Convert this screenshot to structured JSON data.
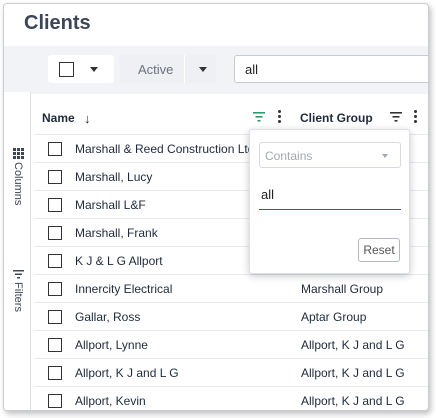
{
  "page": {
    "title": "Clients"
  },
  "toolbar": {
    "status_value": "Active",
    "search_value": "all"
  },
  "side_tabs": {
    "columns": "Columns",
    "filters": "Filters"
  },
  "grid": {
    "columns": [
      {
        "label": "Name",
        "sort": "↓"
      },
      {
        "label": "Client Group"
      }
    ],
    "rows": [
      {
        "name": "Marshall & Reed Construction Ltd",
        "group": ""
      },
      {
        "name": "Marshall, Lucy",
        "group": ""
      },
      {
        "name": "Marshall L&F",
        "group": ""
      },
      {
        "name": "Marshall, Frank",
        "group": ""
      },
      {
        "name": "K J & L G Allport",
        "group": ""
      },
      {
        "name": "Innercity Electrical",
        "group": "Marshall Group"
      },
      {
        "name": "Gallar, Ross",
        "group": "Aptar Group"
      },
      {
        "name": "Allport, Lynne",
        "group": "Allport, K J and L G"
      },
      {
        "name": "Allport, K J and L G",
        "group": "Allport, K J and L G"
      },
      {
        "name": "Allport, Kevin",
        "group": "Allport, K J and L G"
      }
    ]
  },
  "filter_popup": {
    "condition": "Contains",
    "value": "all",
    "reset_label": "Reset"
  },
  "colors": {
    "accent": "#3b5b85",
    "filter_active": "#2a9d6a"
  },
  "icons": {
    "columns": "grid-icon",
    "filters": "filter-icon",
    "sort": "arrow-down-icon",
    "column_menu": "kebab-icon"
  }
}
